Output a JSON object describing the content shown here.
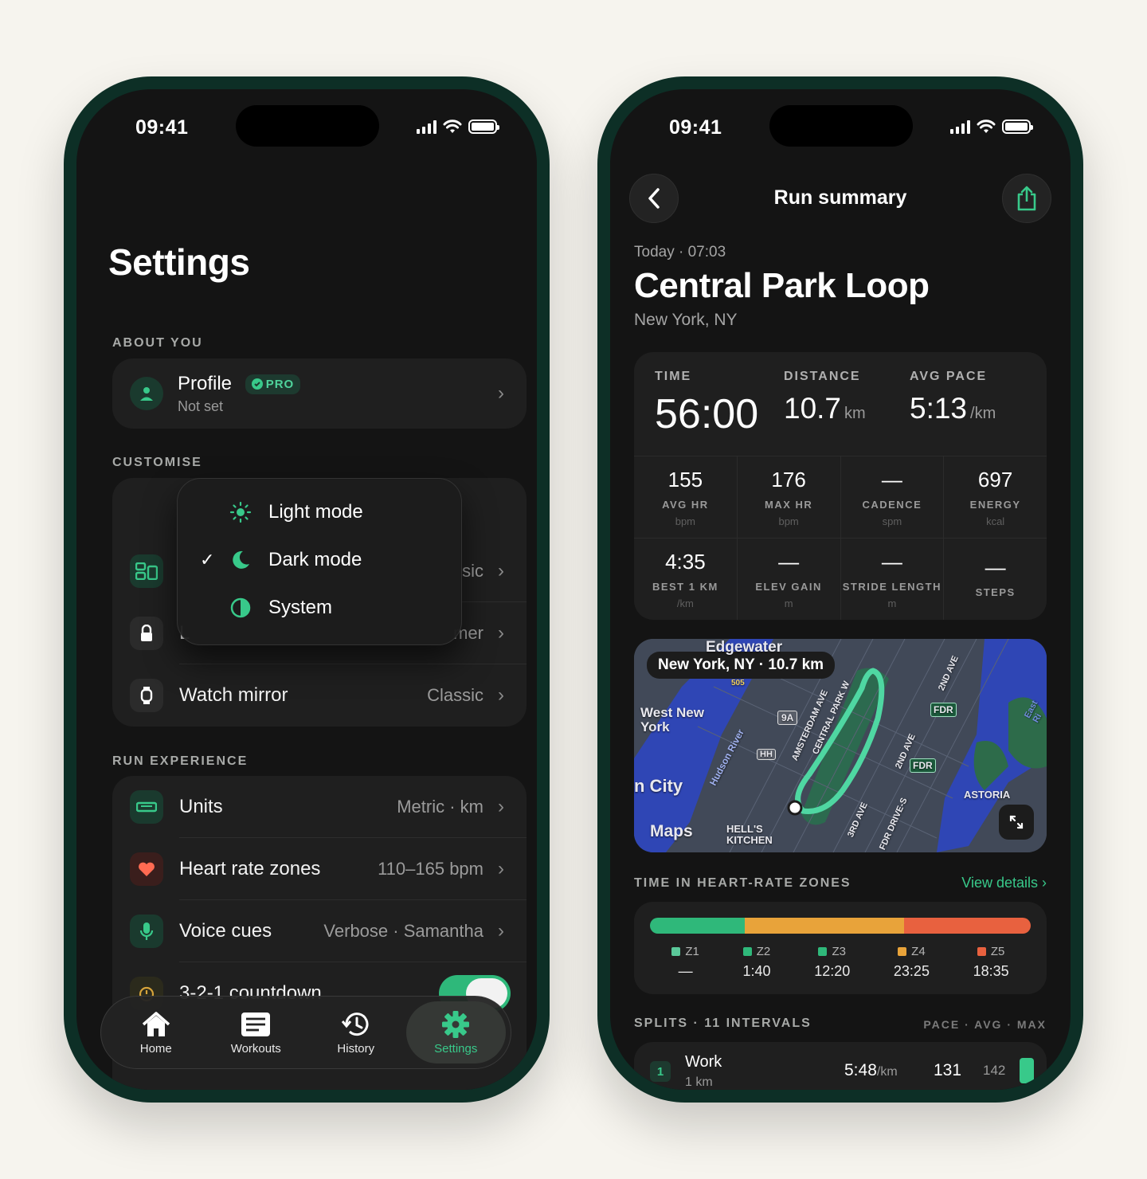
{
  "status": {
    "time": "09:41"
  },
  "settings": {
    "title": "Settings",
    "sections": {
      "about": "ABOUT YOU",
      "customise": "CUSTOMISE",
      "run": "RUN EXPERIENCE"
    },
    "profile": {
      "label": "Profile",
      "badge": "PRO",
      "sub": "Not set"
    },
    "customise_rows": [
      {
        "label": "",
        "value": "sic"
      },
      {
        "label": "L",
        "value": "mer"
      },
      {
        "label": "Watch mirror",
        "value": "Classic"
      }
    ],
    "theme_menu": {
      "items": [
        {
          "label": "Light mode",
          "checked": false
        },
        {
          "label": "Dark mode",
          "checked": true
        },
        {
          "label": "System",
          "checked": false
        }
      ]
    },
    "run_rows": [
      {
        "label": "Units",
        "value": "Metric · km"
      },
      {
        "label": "Heart rate zones",
        "value": "110–165 bpm"
      },
      {
        "label": "Voice cues",
        "value": "Verbose · Samantha"
      },
      {
        "label": "3-2-1 countdown",
        "value": ""
      }
    ],
    "tabs": [
      {
        "label": "Home",
        "icon": "home-icon"
      },
      {
        "label": "Workouts",
        "icon": "workouts-icon"
      },
      {
        "label": "History",
        "icon": "history-icon"
      },
      {
        "label": "Settings",
        "icon": "gear-icon",
        "active": true
      }
    ]
  },
  "summary": {
    "nav_title": "Run summary",
    "date": "Today · 07:03",
    "title": "Central Park Loop",
    "location": "New York, NY",
    "big": {
      "time_label": "TIME",
      "time_value": "56:00",
      "distance_label": "DISTANCE",
      "distance_value": "10.7",
      "distance_unit": "km",
      "pace_label": "AVG PACE",
      "pace_value": "5:13",
      "pace_unit": "/km"
    },
    "metrics": [
      {
        "value": "155",
        "label": "AVG HR",
        "unit": "bpm"
      },
      {
        "value": "176",
        "label": "MAX HR",
        "unit": "bpm"
      },
      {
        "value": "—",
        "label": "CADENCE",
        "unit": "spm"
      },
      {
        "value": "697",
        "label": "ENERGY",
        "unit": "kcal"
      },
      {
        "value": "4:35",
        "label": "BEST 1 KM",
        "unit": "/km"
      },
      {
        "value": "—",
        "label": "ELEV GAIN",
        "unit": "m"
      },
      {
        "value": "—",
        "label": "STRIDE LENGTH",
        "unit": "m"
      },
      {
        "value": "—",
        "label": "STEPS",
        "unit": ""
      }
    ],
    "map": {
      "pill": "New York, NY · 10.7 km",
      "labels": {
        "edgewater": "Edgewater",
        "west_new_york": "West New York",
        "city": "n City",
        "maps": "Maps",
        "hells_kitchen": "HELL'S KITCHEN",
        "astoria": "ASTORIA",
        "hudson": "Hudson River",
        "amsterdam": "AMSTERDAM AVE",
        "central": "CENTRAL PARK W",
        "second_ave": "2ND AVE",
        "second_ave_b": "2ND AVE",
        "third_ave": "3RD AVE",
        "fdr_drive": "FDR DRIVE-S",
        "east": "East Ri",
        "fdr1": "FDR",
        "fdr2": "FDR",
        "nine_a": "9A",
        "hh": "HH",
        "r505": "505"
      }
    },
    "hr_zones": {
      "title": "TIME IN HEART-RATE ZONES",
      "link": "View details",
      "zones": [
        {
          "name": "Z1",
          "value": "—",
          "color": "#5bc99a",
          "fraction": 0
        },
        {
          "name": "Z2",
          "value": "1:40",
          "color": "#2fb87a",
          "fraction": 0.0298
        },
        {
          "name": "Z3",
          "value": "12:20",
          "color": "#2fb87a",
          "fraction": 0.2202
        },
        {
          "name": "Z4",
          "value": "23:25",
          "color": "#e8a33a",
          "fraction": 0.4182
        },
        {
          "name": "Z5",
          "value": "18:35",
          "color": "#e8613f",
          "fraction": 0.3318
        }
      ]
    },
    "splits": {
      "title": "SPLITS · 11 INTERVALS",
      "columns": "PACE · AVG · MAX",
      "rows": [
        {
          "num": "1",
          "name": "Work",
          "sub": "1 km",
          "pace": "5:48",
          "pace_unit": "/km",
          "avg": "131",
          "max": "142"
        }
      ]
    }
  }
}
